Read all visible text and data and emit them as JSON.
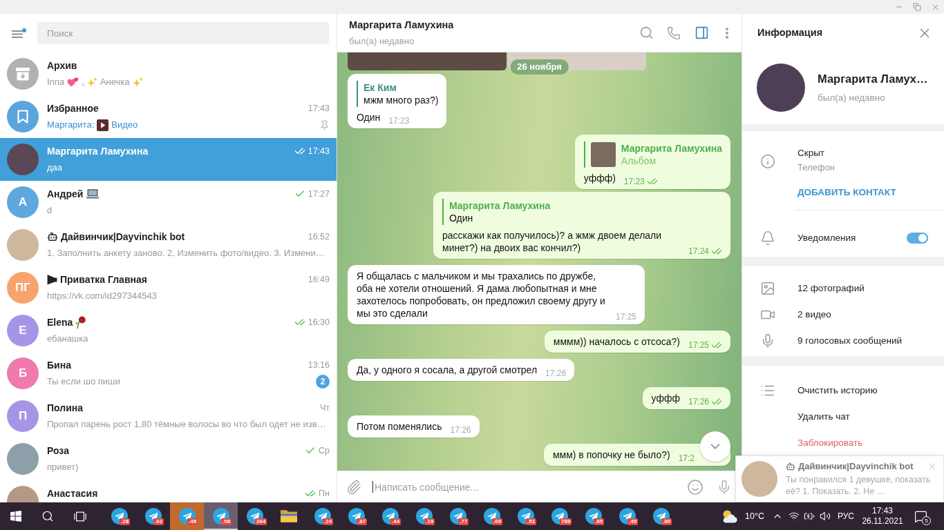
{
  "sidebar": {
    "menu": {
      "has_update": true
    },
    "search": {
      "placeholder": "Поиск"
    },
    "chats": [
      {
        "avatar": {
          "kind": "archive"
        },
        "name": "Архив",
        "preview": [
          {
            "kind": "text",
            "text": "Inna"
          },
          {
            "kind": "hearts"
          },
          {
            "kind": "text",
            "text": ","
          },
          {
            "kind": "sparkles"
          },
          {
            "kind": "text",
            "text": "Анечка"
          },
          {
            "kind": "sparkles"
          }
        ],
        "pinned": false,
        "selected": false
      },
      {
        "avatar": {
          "kind": "saved"
        },
        "name": "Избранное",
        "time": "17:43",
        "preview": [
          {
            "kind": "sender",
            "text": "Маргарита:"
          },
          {
            "kind": "video_thumb"
          },
          {
            "kind": "media",
            "text": "Видео"
          }
        ],
        "pinned": true,
        "selected": false
      },
      {
        "avatar": {
          "kind": "photo"
        },
        "name": "Маргарита Ламухина",
        "time": "17:43",
        "read": true,
        "preview": "даа",
        "pinned": false,
        "selected": true
      },
      {
        "avatar": {
          "kind": "initials",
          "text": "А",
          "color": "#5fa8df"
        },
        "name": "Андрей",
        "name_emoji": {
          "kind": "laptop"
        },
        "time": "17:27",
        "read": false,
        "preview": "d",
        "pinned": false,
        "selected": false
      },
      {
        "avatar": {
          "kind": "photo"
        },
        "name_icon": {
          "kind": "bot"
        },
        "name": "Дайвинчик|Dayvinchik bot",
        "time": "16:52",
        "preview": "1. Заполнить анкету заново. 2. Изменить фото/видео. 3. Измени…",
        "pinned": false,
        "selected": false
      },
      {
        "avatar": {
          "kind": "initials",
          "text": "ПГ",
          "color": "#f6a36d"
        },
        "name_icon": {
          "kind": "channel"
        },
        "name": "Приватка Главная",
        "time": "16:49",
        "preview": "https://vk.com/id297344543",
        "pinned": false,
        "selected": false
      },
      {
        "avatar": {
          "kind": "initials",
          "text": "E",
          "color": "#a695e7"
        },
        "name": "Elena",
        "name_emoji": {
          "kind": "rose"
        },
        "time": "16:30",
        "read": true,
        "preview": "ебанашка",
        "pinned": false,
        "selected": false
      },
      {
        "avatar": {
          "kind": "initials",
          "text": "Б",
          "color": "#ee7aae"
        },
        "name": "Бина",
        "time": "13:16",
        "preview": "Ты если шо пиши",
        "unread": "2",
        "pinned": false,
        "selected": false
      },
      {
        "avatar": {
          "kind": "initials",
          "text": "П",
          "color": "#a695e7"
        },
        "name": "Полина",
        "time": "Чт",
        "preview": "Пропал парень рост 1,80 тёмные волосы во что был одет не изв…",
        "pinned": false,
        "selected": false
      },
      {
        "avatar": {
          "kind": "photo"
        },
        "name": "Роза",
        "time": "Ср",
        "read": false,
        "preview": "привет)",
        "pinned": false,
        "selected": false
      },
      {
        "avatar": {
          "kind": "photo"
        },
        "name": "Анастасия",
        "time": "Пн",
        "read": true,
        "pinned": false,
        "selected": false
      }
    ]
  },
  "chat": {
    "title": "Маргарита Ламухина",
    "status": "был(а) недавно",
    "info_open": true,
    "album": [
      {
        "kind": "photo"
      },
      {
        "kind": "photo"
      }
    ],
    "date": "26 ноября",
    "messages": [
      {
        "outgoing": false,
        "reply": {
          "kind": "text",
          "author": "Ек Ким",
          "text": "мжм много раз?)",
          "color": "#3a8f85"
        },
        "text": "Один",
        "time": "17:23"
      },
      {
        "outgoing": true,
        "reply": {
          "kind": "media",
          "author": "Маргарита Ламухина",
          "text": "Альбом",
          "color": "#4fae4e"
        },
        "text": "уффф)",
        "time": "17:23",
        "read": true
      },
      {
        "outgoing": true,
        "reply": {
          "kind": "text",
          "author": "Маргарита Ламухина",
          "text": "Один",
          "color": "#4fae4e"
        },
        "text": "расскажи как получилось)? а жмж двоем делали минет?) на двоих вас кончил?)",
        "time": "17:24",
        "read": true
      },
      {
        "outgoing": false,
        "text": "Я общалась с мальчиком и мы трахались по дружбе, оба не хотели отношений. Я дама любопытная и мне захотелось попробовать, он предложил своему другу и мы это сделали",
        "time": "17:25"
      },
      {
        "outgoing": true,
        "text": "мммм)) началось с отсоса?)",
        "time": "17:25",
        "read": true
      },
      {
        "outgoing": false,
        "text": "Да, у одного я сосала, а другой смотрел",
        "time": "17:26"
      },
      {
        "outgoing": true,
        "text": "уффф",
        "time": "17:26",
        "read": true
      },
      {
        "outgoing": false,
        "text": "Потом поменялись",
        "time": "17:26"
      },
      {
        "outgoing": true,
        "text": "ммм) в попочку не было?)",
        "time": "17:2"
      }
    ],
    "scroll_down": true,
    "composer": {
      "placeholder": "Написать сообщение..."
    }
  },
  "info": {
    "title": "Информация",
    "name": "Маргарита Ламух…",
    "status": "был(а) недавно",
    "phone": {
      "value": "Скрыт",
      "label": "Телефон"
    },
    "add_contact": "ДОБАВИТЬ КОНТАКТ",
    "notifications": {
      "label": "Уведомления",
      "on": true
    },
    "media": [
      {
        "kind": "photo",
        "label": "12 фотографий"
      },
      {
        "kind": "video",
        "label": "2 видео"
      },
      {
        "kind": "voice",
        "label": "9 голосовых сообщений"
      }
    ],
    "actions": [
      {
        "kind": "clear",
        "label": "Очистить историю"
      },
      {
        "kind": "delete",
        "label": "Удалить чат"
      },
      {
        "kind": "block",
        "label": "Заблокировать"
      }
    ]
  },
  "notification": {
    "title": "Дайвинчик|Dayvinchik bot",
    "text": "Ты понравился 1 девушке, показать её? 1. Показать. 2. Не …"
  },
  "taskbar": {
    "apps": [
      {
        "kind": "telegram",
        "badge": ".28",
        "active": false,
        "flashing": false
      },
      {
        "kind": "telegram",
        "badge": ".62",
        "active": false,
        "flashing": false
      },
      {
        "kind": "telegram",
        "badge": ".45",
        "active": false,
        "flashing": true
      },
      {
        "kind": "telegram",
        "badge": ".08",
        "active": true,
        "flashing": false
      },
      {
        "kind": "telegram",
        "badge": "264",
        "active": false,
        "flashing": false
      },
      {
        "kind": "explorer",
        "active": false,
        "flashing": false
      },
      {
        "kind": "telegram",
        "badge": ".24",
        "active": false,
        "flashing": false
      },
      {
        "kind": "telegram",
        "badge": ".87",
        "active": false,
        "flashing": false
      },
      {
        "kind": "telegram",
        "badge": ".44",
        "active": false,
        "flashing": false
      },
      {
        "kind": "telegram",
        "badge": ".19",
        "active": false,
        "flashing": false
      },
      {
        "kind": "telegram",
        "badge": ".77",
        "active": false,
        "flashing": false
      },
      {
        "kind": "telegram",
        "badge": ".69",
        "active": false,
        "flashing": false
      },
      {
        "kind": "telegram",
        "badge": ".51",
        "active": false,
        "flashing": false
      },
      {
        "kind": "telegram",
        "badge": "789",
        "active": false,
        "flashing": false
      },
      {
        "kind": "telegram",
        "badge": ".85",
        "active": false,
        "flashing": false
      },
      {
        "kind": "telegram",
        "badge": ".45",
        "active": false,
        "flashing": false
      },
      {
        "kind": "telegram",
        "badge": ".80",
        "active": false,
        "flashing": false
      }
    ],
    "weather": "10°C",
    "language": "РУС",
    "time": "17:43",
    "date": "26.11.2021",
    "notifications": "5"
  }
}
